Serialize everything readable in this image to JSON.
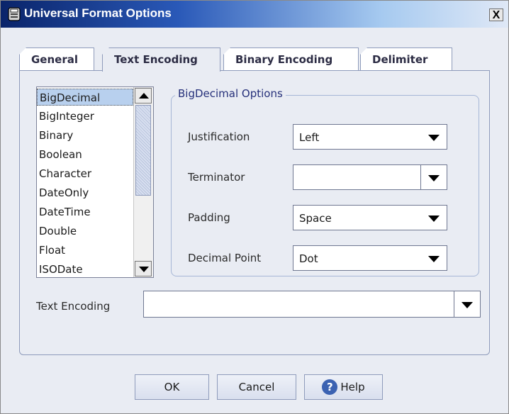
{
  "window": {
    "title": "Universal Format Options",
    "close_glyph": "X"
  },
  "tabs": [
    {
      "label": "General",
      "active": false
    },
    {
      "label": "Text Encoding",
      "active": true
    },
    {
      "label": "Binary Encoding",
      "active": false
    },
    {
      "label": "Delimiter",
      "active": false
    }
  ],
  "type_list": {
    "items": [
      "BigDecimal",
      "BigInteger",
      "Binary",
      "Boolean",
      "Character",
      "DateOnly",
      "DateTime",
      "Double",
      "Float",
      "ISODate"
    ],
    "selected": "BigDecimal"
  },
  "options_group": {
    "legend": "BigDecimal Options",
    "fields": [
      {
        "label": "Justification",
        "value": "Left"
      },
      {
        "label": "Terminator",
        "value": ""
      },
      {
        "label": "Padding",
        "value": "Space"
      },
      {
        "label": "Decimal Point",
        "value": "Dot"
      }
    ]
  },
  "text_encoding": {
    "label": "Text Encoding",
    "value": ""
  },
  "buttons": {
    "ok": "OK",
    "cancel": "Cancel",
    "help": "Help",
    "help_glyph": "?"
  },
  "colors": {
    "title_start": "#0a246a",
    "title_end": "#dfe8f6",
    "selection": "#b8d0ee",
    "legend_text": "#26307a",
    "dialog_bg": "#e9ecf3"
  },
  "icons": [
    "app-icon",
    "close-icon",
    "scroll-up-icon",
    "scroll-down-icon",
    "dropdown-arrow-icon",
    "help-icon"
  ]
}
